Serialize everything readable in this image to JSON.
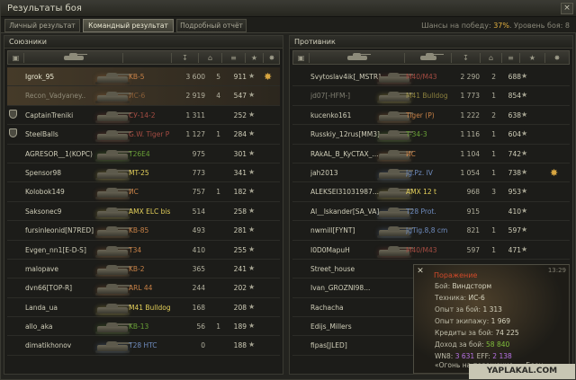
{
  "window": {
    "title": "Результаты боя",
    "close": "×"
  },
  "tabs": [
    {
      "label": "Личный результат"
    },
    {
      "label": "Командный результат"
    },
    {
      "label": "Подробный отчёт"
    }
  ],
  "chances": {
    "prefix": "Шансы на победу: ",
    "value": "37%",
    "suffix": ". Уровень боя: 8"
  },
  "icons": {
    "platoon": "platoon-icon",
    "tank": "tank-icon",
    "damage": "damage-icon",
    "kills": "kills-icon",
    "xp": "xp-icon",
    "star": "star-icon",
    "medal": "medal-icon"
  },
  "colors": {
    "light": "#e3cf5a",
    "medium": "#69a036",
    "heavy": "#c78046",
    "td": "#6f8cbf",
    "spg": "#a44c42",
    "highlight_text": "#f0eed8"
  },
  "allies": {
    "title": "Союзники",
    "rows": [
      {
        "player": "Igrok_95",
        "tank": "KB-5",
        "damage": "3 600",
        "kills": "5",
        "xp": "911",
        "star": "★",
        "medal": "✸",
        "cls": "heavy",
        "hl": "hl",
        "platoon": false
      },
      {
        "player": "Recon_Vadyaney..",
        "tank": "ИС-6",
        "damage": "2 919",
        "kills": "4",
        "xp": "547",
        "star": "★",
        "medal": "",
        "cls": "heavy",
        "hl": "hl",
        "platoon": false,
        "dim": true
      },
      {
        "player": "CaptainTreniki",
        "tank": "СУ-14-2",
        "damage": "1 311",
        "kills": "",
        "xp": "252",
        "star": "★",
        "medal": "",
        "cls": "spg",
        "hl": "",
        "platoon": true
      },
      {
        "player": "SteelBalls",
        "tank": "G.W. Tiger P",
        "damage": "1 127",
        "kills": "1",
        "xp": "284",
        "star": "★",
        "medal": "",
        "cls": "spg",
        "hl": "",
        "platoon": true
      },
      {
        "player": "AGRESOR__1(KOPC)",
        "tank": "T26E4",
        "damage": "975",
        "kills": "",
        "xp": "301",
        "star": "★",
        "medal": "",
        "cls": "medium",
        "hl": "",
        "platoon": false
      },
      {
        "player": "Spensor98",
        "tank": "MT-25",
        "damage": "773",
        "kills": "",
        "xp": "341",
        "star": "★",
        "medal": "",
        "cls": "light",
        "hl": "",
        "platoon": false
      },
      {
        "player": "Kolobok149",
        "tank": "ИС",
        "damage": "757",
        "kills": "1",
        "xp": "182",
        "star": "★",
        "medal": "",
        "cls": "heavy",
        "hl": "",
        "platoon": false
      },
      {
        "player": "Saksonec9",
        "tank": "AMX ELC bis",
        "damage": "514",
        "kills": "",
        "xp": "258",
        "star": "★",
        "medal": "",
        "cls": "light",
        "hl": "",
        "platoon": false
      },
      {
        "player": "fursinleonid[N7RED]",
        "tank": "KB-85",
        "damage": "493",
        "kills": "",
        "xp": "281",
        "star": "★",
        "medal": "",
        "cls": "heavy",
        "hl": "",
        "platoon": false
      },
      {
        "player": "Evgen_nn1[E-D-S]",
        "tank": "T34",
        "damage": "410",
        "kills": "",
        "xp": "255",
        "star": "★",
        "medal": "",
        "cls": "heavy",
        "hl": "",
        "platoon": false
      },
      {
        "player": "malopave",
        "tank": "KB-2",
        "damage": "365",
        "kills": "",
        "xp": "241",
        "star": "★",
        "medal": "",
        "cls": "heavy",
        "hl": "",
        "platoon": false
      },
      {
        "player": "dvn66[TOP-R]",
        "tank": "ARL 44",
        "damage": "244",
        "kills": "",
        "xp": "202",
        "star": "★",
        "medal": "",
        "cls": "heavy",
        "hl": "",
        "platoon": false
      },
      {
        "player": "Landa_ua",
        "tank": "M41 Bulldog",
        "damage": "168",
        "kills": "",
        "xp": "208",
        "star": "★",
        "medal": "",
        "cls": "light",
        "hl": "",
        "platoon": false
      },
      {
        "player": "allo_aka",
        "tank": "KB-13",
        "damage": "56",
        "kills": "1",
        "xp": "189",
        "star": "★",
        "medal": "",
        "cls": "medium",
        "hl": "",
        "platoon": false
      },
      {
        "player": "dimatikhonov",
        "tank": "T28 HTC",
        "damage": "0",
        "kills": "",
        "xp": "188",
        "star": "★",
        "medal": "",
        "cls": "td",
        "hl": "",
        "platoon": false
      }
    ]
  },
  "enemies": {
    "title": "Противник",
    "rows": [
      {
        "player": "Svytoslav4ik[_MSTR]",
        "tank": "M40/M43",
        "damage": "2 290",
        "kills": "2",
        "xp": "688",
        "star": "★",
        "medal": "",
        "cls": "spg",
        "hl": "",
        "platoon": false
      },
      {
        "player": "jd07[-HFM-]",
        "tank": "M41 Bulldog",
        "damage": "1 773",
        "kills": "1",
        "xp": "854",
        "star": "★",
        "medal": "",
        "cls": "light",
        "hl": "",
        "platoon": false,
        "dim": true
      },
      {
        "player": "kucenko161",
        "tank": "Tiger (P)",
        "damage": "1 222",
        "kills": "2",
        "xp": "638",
        "star": "★",
        "medal": "",
        "cls": "heavy",
        "hl": "",
        "platoon": false
      },
      {
        "player": "Russkiy_12rus[MM3]",
        "tank": "T-34-3",
        "damage": "1 116",
        "kills": "1",
        "xp": "604",
        "star": "★",
        "medal": "",
        "cls": "medium",
        "hl": "",
        "platoon": false
      },
      {
        "player": "RAkAL_B_KyCTAX_...",
        "tank": "ИС",
        "damage": "1 104",
        "kills": "1",
        "xp": "742",
        "star": "★",
        "medal": "",
        "cls": "heavy",
        "hl": "",
        "platoon": false
      },
      {
        "player": "jah2013",
        "tank": "Jg.Pz. IV",
        "damage": "1 054",
        "kills": "1",
        "xp": "738",
        "star": "★",
        "medal": "✸",
        "cls": "td",
        "hl": "",
        "platoon": false
      },
      {
        "player": "ALEKSEI31031987...",
        "tank": "AMX 12 t",
        "damage": "968",
        "kills": "3",
        "xp": "953",
        "star": "★",
        "medal": "",
        "cls": "light",
        "hl": "",
        "platoon": false
      },
      {
        "player": "Al__Iskander[SA_VA]",
        "tank": "T28 Prot.",
        "damage": "915",
        "kills": "",
        "xp": "410",
        "star": "★",
        "medal": "",
        "cls": "td",
        "hl": "",
        "platoon": false
      },
      {
        "player": "nwmill[FYNT]",
        "tank": "JgTig.8,8 cm",
        "damage": "821",
        "kills": "1",
        "xp": "597",
        "star": "★",
        "medal": "",
        "cls": "td",
        "hl": "",
        "platoon": false
      },
      {
        "player": "I0D0MapuH",
        "tank": "M40/M43",
        "damage": "597",
        "kills": "1",
        "xp": "471",
        "star": "★",
        "medal": "",
        "cls": "spg",
        "hl": "",
        "platoon": false
      },
      {
        "player": "Street_house",
        "tank": "",
        "damage": "",
        "kills": "",
        "xp": "",
        "star": "",
        "medal": "",
        "cls": "medium",
        "hl": "",
        "platoon": false
      },
      {
        "player": "Ivan_GROZNI98...",
        "tank": "",
        "damage": "",
        "kills": "",
        "xp": "",
        "star": "",
        "medal": "",
        "cls": "medium",
        "hl": "",
        "platoon": false
      },
      {
        "player": "Rachacha",
        "tank": "",
        "damage": "",
        "kills": "",
        "xp": "",
        "star": "",
        "medal": "",
        "cls": "medium",
        "hl": "",
        "platoon": false
      },
      {
        "player": "Edijs_Millers",
        "tank": "",
        "damage": "",
        "kills": "",
        "xp": "",
        "star": "",
        "medal": "",
        "cls": "medium",
        "hl": "",
        "platoon": false
      },
      {
        "player": "fipas[JLED]",
        "tank": "",
        "damage": "",
        "kills": "",
        "xp": "",
        "star": "",
        "medal": "",
        "cls": "medium",
        "hl": "",
        "platoon": false
      }
    ]
  },
  "tooltip": {
    "close": "✕",
    "time": "13:29",
    "result": "Поражение",
    "lines": [
      {
        "label": "Бой: ",
        "value": "Виндсторм",
        "cls": ""
      },
      {
        "label": "Техника: ",
        "value": "ИС-6",
        "cls": ""
      },
      {
        "label": "Опыт за бой: ",
        "value": "1 313",
        "cls": ""
      },
      {
        "label": "Опыт экипажу: ",
        "value": "1 969",
        "cls": ""
      },
      {
        "label": "Кредиты за бой: ",
        "value": "74 225",
        "cls": ""
      },
      {
        "label": "Доход за бой: ",
        "value": "58 840",
        "cls": "v-green"
      }
    ],
    "wn8_label": "WN8: ",
    "wn8_value": "3 631",
    "eff_label": " EFF: ",
    "eff_value": "2 138",
    "awards": "«Огонь на поражение»; «Боец»"
  },
  "watermark": "YAPLAKAL.COM"
}
